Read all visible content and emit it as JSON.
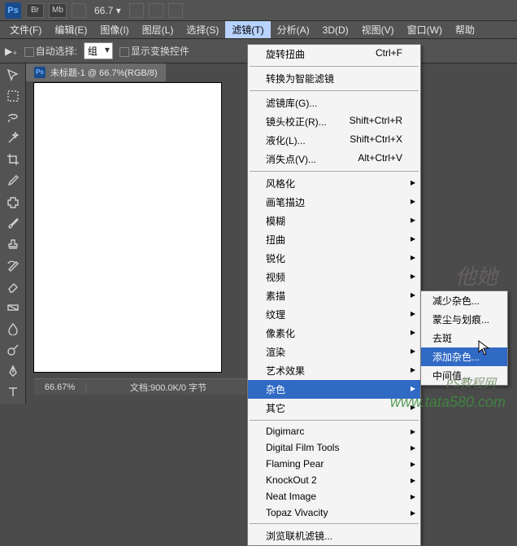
{
  "top": {
    "zoom_display": "66.7",
    "btn_br": "Br",
    "btn_mb": "Mb"
  },
  "menubar": {
    "items": [
      "文件(F)",
      "编辑(E)",
      "图像(I)",
      "图层(L)",
      "选择(S)",
      "滤镜(T)",
      "分析(A)",
      "3D(D)",
      "视图(V)",
      "窗口(W)",
      "帮助"
    ],
    "active_index": 5
  },
  "optbar": {
    "auto_select": "自动选择:",
    "group": "组",
    "show_transform": "显示变换控件"
  },
  "document": {
    "tab_title": "未标题-1 @ 66.7%(RGB/8)",
    "status_pct": "66.67%",
    "status_doc": "文档:900.0K/0 字节"
  },
  "filter_menu": {
    "last": {
      "label": "旋转扭曲",
      "shortcut": "Ctrl+F"
    },
    "smart": "转换为智能滤镜",
    "group1": [
      {
        "label": "滤镜库(G)...",
        "shortcut": ""
      },
      {
        "label": "镜头校正(R)...",
        "shortcut": "Shift+Ctrl+R"
      },
      {
        "label": "液化(L)...",
        "shortcut": "Shift+Ctrl+X"
      },
      {
        "label": "消失点(V)...",
        "shortcut": "Alt+Ctrl+V"
      }
    ],
    "group2": [
      "风格化",
      "画笔描边",
      "模糊",
      "扭曲",
      "锐化",
      "视频",
      "素描",
      "纹理",
      "像素化",
      "渲染",
      "艺术效果",
      "杂色",
      "其它"
    ],
    "hilite_g2_index": 11,
    "group3": [
      "Digimarc",
      "Digital Film Tools",
      "Flaming Pear",
      "KnockOut 2",
      "Neat Image",
      "Topaz Vivacity"
    ],
    "browse": "浏览联机滤镜..."
  },
  "submenu": {
    "items": [
      "减少杂色...",
      "蒙尘与划痕...",
      "去斑",
      "添加杂色...",
      "中间值..."
    ],
    "hilite_index": 3
  },
  "watermark": {
    "brand": "他她",
    "site": "PS教程网",
    "url": "www.tata580.com"
  }
}
